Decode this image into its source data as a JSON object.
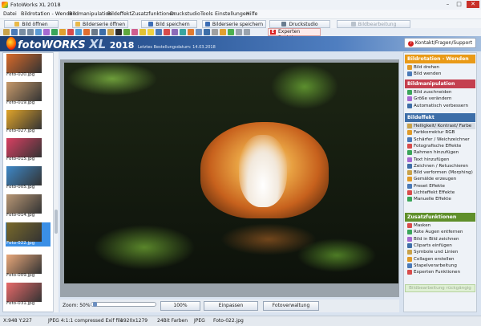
{
  "window": {
    "title": "FotoWorks XL 2018",
    "minimize": "–",
    "maximize": "□",
    "close": "✕"
  },
  "menu": [
    "Datei",
    "Bildrotation - Wenden",
    "Bildmanipulation",
    "Bildeffekt",
    "Zusatzfunktionen",
    "Druckstudio",
    "Tools",
    "Einstellungen",
    "Hilfe"
  ],
  "toolbar1": {
    "open": "Bild öffnen",
    "open_series": "Bilderserie öffnen",
    "save": "Bild speichern",
    "save_series": "Bilderserie speichern",
    "print": "Druckstudio",
    "batch_reverse": "Bildbearbeitung rückgängig"
  },
  "expert_button": "Experten Funktionen",
  "header": {
    "brand_main": "fotoWORKS",
    "brand_xl": "XL",
    "brand_year": "2018",
    "last_order": "Letztes Bestellungsdatum: 14.03.2018"
  },
  "kontakt_button": "Kontakt/Fragen/Support",
  "thumbnails": [
    {
      "name": "Foto-020.jpg",
      "color": "#d96a2a"
    },
    {
      "name": "Foto-019.jpg",
      "color": "#c79a6b"
    },
    {
      "name": "Foto-027.jpg",
      "color": "#e0a42a"
    },
    {
      "name": "Foto-015.jpg",
      "color": "#d94062"
    },
    {
      "name": "Foto-005.jpg",
      "color": "#3e88c8"
    },
    {
      "name": "Foto-014.jpg",
      "color": "#b89775"
    },
    {
      "name": "Foto-022.jpg",
      "color": "#7a6a2a"
    },
    {
      "name": "Foto-009.jpg",
      "color": "#e9a87a"
    },
    {
      "name": "Foto-031.jpg",
      "color": "#e86a6a"
    }
  ],
  "zoom": {
    "label": "Zoom: 50%",
    "value_percent": 50
  },
  "bottom_buttons": {
    "full": "100%",
    "fit": "Einpassen",
    "manage": "Fotoverwaltung"
  },
  "sections": [
    {
      "title": "Bildrotation - Wenden",
      "color": "#e99a17",
      "items": [
        "Bild drehen",
        "Bild wenden"
      ]
    },
    {
      "title": "Bildmanipulation",
      "color": "#c43f4f",
      "items": [
        "Bild zuschneiden",
        "Größe verändern",
        "Automatisch verbessern"
      ]
    },
    {
      "title": "Bildeffekt",
      "color": "#3d6ea8",
      "items": [
        "Helligkeit/ Kontrast/ Farbe",
        "Farbkorrektur RGB",
        "Schärfer / Weichzeichner",
        "Fotografische Effekte",
        "Rahmen hinzufügen",
        "Text hinzufügen",
        "Zeichnen / Retuschieren",
        "Bild verformen (Morphing)",
        "Gemälde erzeugen",
        "Preset Effekte",
        "Lichteffekt Effekte",
        "Manuelle Effekte"
      ]
    },
    {
      "title": "Zusatzfunktionen",
      "color": "#5f8f2a",
      "items": [
        "Masken",
        "Rote Augen entfernen",
        "Bild in Bild zeichnen",
        "Cliparts einfügen",
        "Symbole und Linien",
        "Collagen erstellen",
        "Stapelverarbeitung",
        "Experten Funktionen"
      ]
    }
  ],
  "right_disabled": "Bildbearbeitung rückgängig",
  "status": {
    "coords": "X:948 Y:227",
    "format": "JPEG 4:1:1 compressed Exif file",
    "dims": "1920x1279",
    "colors": "24Bit Farben",
    "type": "JPEG",
    "file": "Foto-022.jpg"
  }
}
